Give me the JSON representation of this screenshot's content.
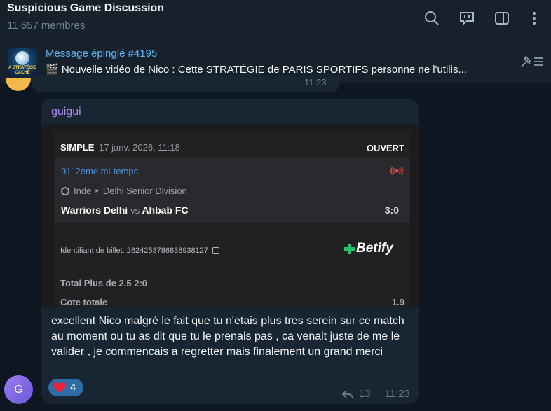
{
  "header": {
    "title": "Suspicious Game Discussion",
    "members": "11 657 membres"
  },
  "header_icons": [
    "search-icon",
    "discussion-icon",
    "sidebar-icon",
    "more-icon"
  ],
  "pinned": {
    "title": "Message épinglé #4195",
    "text": "🎬 Nouvelle vidéo de Nico : Cette STRATÉGIE de PARIS SPORTIFS personne ne l'utilis...",
    "thumb_caption": "A STRATÉGIE CACHÉ"
  },
  "previous_message": {
    "time": "11:23"
  },
  "message": {
    "sender": "guigui",
    "ticket": {
      "type": "SIMPLE",
      "date": "17 janv. 2026, 11:18",
      "status": "OUVERT",
      "live": "91' 2ème mi-temps",
      "country": "Inde",
      "league": "Delhi Senior Division",
      "team_home": "Warriors Delhi",
      "vs": "vs",
      "team_away": "Ahbab FC",
      "score": "3:0",
      "ticket_id": "Identifiant de billet: 2624253786838938127",
      "brand": "Betify",
      "bet": "Total Plus de 2.5   2:0",
      "odds_label": "Cote totale",
      "odds_value": "1.9"
    },
    "text": "excellent Nico malgré le fait que tu n'etais plus tres serein sur ce match au moment ou tu as dit que tu le prenais pas , ca venait juste de me le valider , je commencais a regretter mais finalement un grand merci",
    "reaction": {
      "emoji": "heart-icon",
      "count": "4"
    },
    "replies": "13",
    "time": "11:23",
    "avatar_letter": "G"
  },
  "colors": {
    "background": "#0e1621",
    "header": "#17212b",
    "bubble": "#182533",
    "accent": "#5eb5f7",
    "sender": "#b18cf0",
    "reaction": "#2f6ea5",
    "betify_green": "#27c26b"
  }
}
